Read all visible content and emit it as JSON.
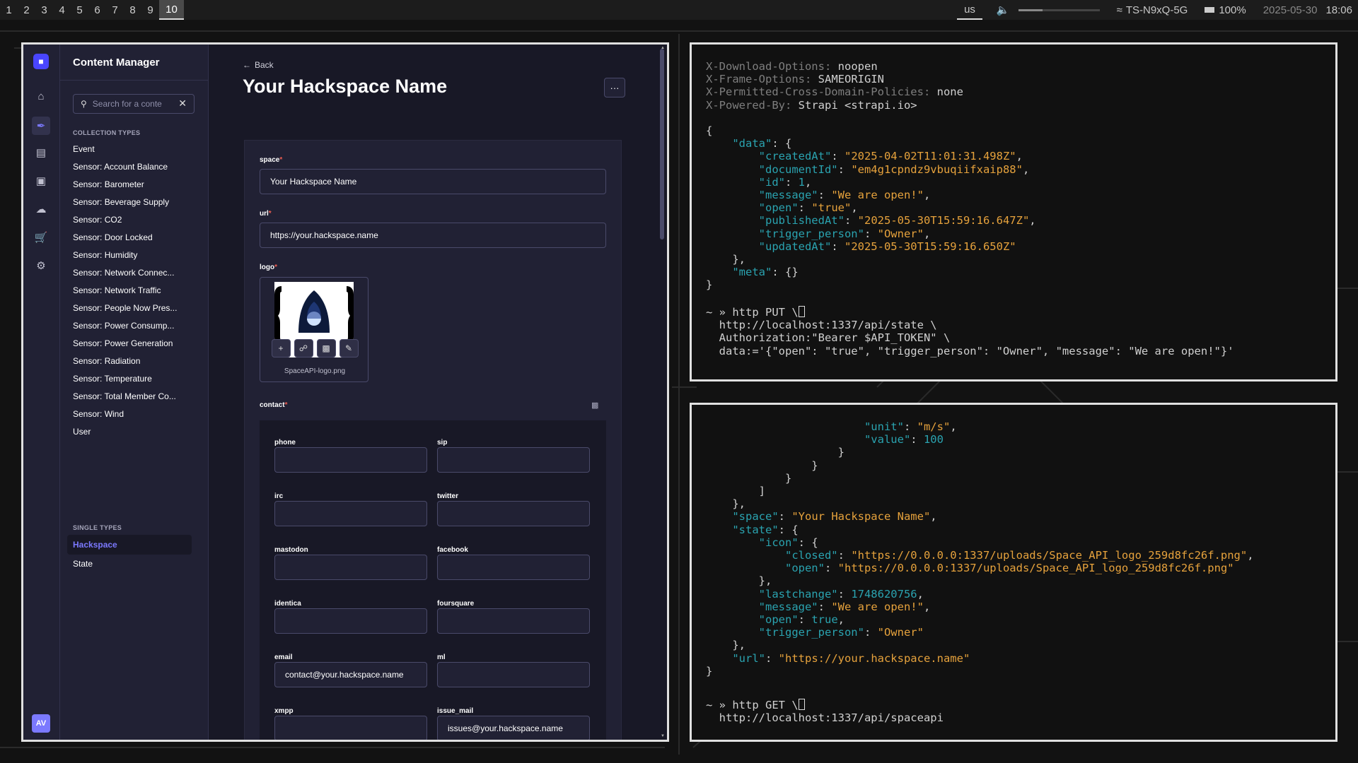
{
  "topbar": {
    "workspaces": [
      "1",
      "2",
      "3",
      "4",
      "5",
      "6",
      "7",
      "8",
      "9",
      "10"
    ],
    "active_workspace": "10",
    "keyboard_layout": "us",
    "wifi": "TS-N9xQ-5G",
    "battery": "100%",
    "date": "2025-05-30",
    "time": "18:06",
    "volume_level": 0.3
  },
  "strapi": {
    "sidebar_title": "Content Manager",
    "search_placeholder": "Search for a conte",
    "collection_types_title": "COLLECTION TYPES",
    "collection_types": [
      "Event",
      "Sensor: Account Balance",
      "Sensor: Barometer",
      "Sensor: Beverage Supply",
      "Sensor: CO2",
      "Sensor: Door Locked",
      "Sensor: Humidity",
      "Sensor: Network Connec...",
      "Sensor: Network Traffic",
      "Sensor: People Now Pres...",
      "Sensor: Power Consump...",
      "Sensor: Power Generation",
      "Sensor: Radiation",
      "Sensor: Temperature",
      "Sensor: Total Member Co...",
      "Sensor: Wind",
      "User"
    ],
    "single_types_title": "SINGLE TYPES",
    "single_types": [
      "Hackspace",
      "State"
    ],
    "active_single_type": "Hackspace",
    "avatar_initials": "AV",
    "back_label": "Back",
    "page_title": "Your Hackspace Name",
    "more_label": "···",
    "fields": {
      "space_label": "space",
      "space_value": "Your Hackspace Name",
      "url_label": "url",
      "url_value": "https://your.hackspace.name",
      "logo_label": "logo",
      "logo_filename": "SpaceAPI-logo.png",
      "contact_label": "contact"
    },
    "contact_fields": [
      {
        "label": "phone",
        "value": ""
      },
      {
        "label": "sip",
        "value": ""
      },
      {
        "label": "irc",
        "value": ""
      },
      {
        "label": "twitter",
        "value": ""
      },
      {
        "label": "mastodon",
        "value": ""
      },
      {
        "label": "facebook",
        "value": ""
      },
      {
        "label": "identica",
        "value": ""
      },
      {
        "label": "foursquare",
        "value": ""
      },
      {
        "label": "email",
        "value": "contact@your.hackspace.name"
      },
      {
        "label": "ml",
        "value": ""
      },
      {
        "label": "xmpp",
        "value": ""
      },
      {
        "label": "issue_mail",
        "value": "issues@your.hackspace.name"
      }
    ]
  },
  "terminal_top": {
    "headers": [
      {
        "key": "X-Download-Options",
        "value": "noopen"
      },
      {
        "key": "X-Frame-Options",
        "value": "SAMEORIGIN"
      },
      {
        "key": "X-Permitted-Cross-Domain-Policies",
        "value": "none"
      },
      {
        "key": "X-Powered-By",
        "value": "Strapi <strapi.io>"
      }
    ],
    "data": {
      "createdAt": "\"2025-04-02T11:01:31.498Z\"",
      "documentId": "\"em4g1cpndz9vbuqiifxaip88\"",
      "id": "1",
      "message": "\"We are open!\"",
      "open": "\"true\"",
      "publishedAt": "\"2025-05-30T15:59:16.647Z\"",
      "trigger_person": "\"Owner\"",
      "updatedAt": "\"2025-05-30T15:59:16.650Z\""
    },
    "meta": "{}",
    "prompt": "~ »",
    "command_lines": [
      "http PUT \\",
      "  http://localhost:1337/api/state \\",
      "  Authorization:\"Bearer $API_TOKEN\" \\",
      "  data:='{\"open\": \"true\", \"trigger_person\": \"Owner\", \"message\": \"We are open!\"}'"
    ]
  },
  "terminal_bottom": {
    "unit": "\"m/s\"",
    "value": "100",
    "space": "\"Your Hackspace Name\"",
    "icon_closed": "\"https://0.0.0.0:1337/uploads/Space_API_logo_259d8fc26f.png\"",
    "icon_open": "\"https://0.0.0.0:1337/uploads/Space_API_logo_259d8fc26f.png\"",
    "lastchange": "1748620756",
    "message": "\"We are open!\"",
    "open": "true",
    "trigger_person": "\"Owner\"",
    "url": "\"https://your.hackspace.name\"",
    "prompt": "~ »",
    "command_lines": [
      "http GET \\",
      "  http://localhost:1337/api/spaceapi"
    ]
  },
  "colors": {
    "strapi_primary": "#7b79ff",
    "json_key": "#2aa3b0",
    "json_string": "#e6a23c",
    "required_star": "#ee5e52"
  },
  "icons": {
    "rail": [
      "strapi-logo-icon",
      "home-icon",
      "feather-icon",
      "media-library-icon",
      "layout-icon",
      "cloud-icon",
      "cart-icon",
      "settings-icon"
    ],
    "logo_actions": [
      "plus-icon",
      "link-icon",
      "trash-icon",
      "pencil-icon"
    ]
  }
}
